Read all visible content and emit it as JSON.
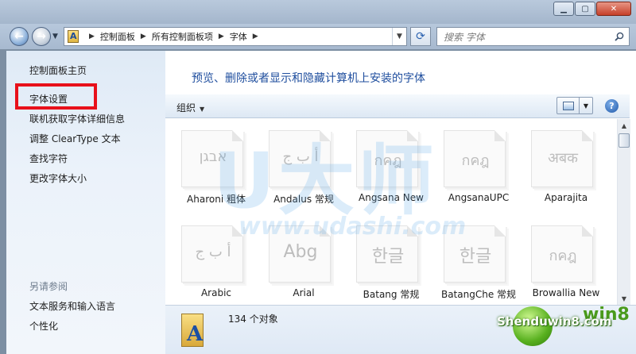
{
  "address_bar": {
    "breadcrumbs": [
      "控制面板",
      "所有控制面板项",
      "字体"
    ]
  },
  "search": {
    "placeholder": "搜索 字体"
  },
  "sidebar": {
    "home": "控制面板主页",
    "links": [
      "字体设置",
      "联机获取字体详细信息",
      "调整 ClearType 文本",
      "查找字符",
      "更改字体大小"
    ],
    "see_also_title": "另请参阅",
    "see_also": [
      "文本服务和输入语言",
      "个性化"
    ]
  },
  "main": {
    "title": "预览、删除或者显示和隐藏计算机上安装的字体",
    "organize": "组织",
    "fonts": [
      {
        "name": "Aharoni 粗体",
        "sample": "אבגן"
      },
      {
        "name": "Andalus 常规",
        "sample": "أ ب ج"
      },
      {
        "name": "Angsana New",
        "sample": "กคฎ"
      },
      {
        "name": "AngsanaUPC",
        "sample": "กคฎ"
      },
      {
        "name": "Aparajita",
        "sample": "अबक"
      },
      {
        "name": "Arabic",
        "sample": "أ ب ج"
      },
      {
        "name": "Arial",
        "sample": "Abg"
      },
      {
        "name": "Batang 常规",
        "sample": "한글"
      },
      {
        "name": "BatangChe 常规",
        "sample": "한글"
      },
      {
        "name": "Browallia New",
        "sample": "กคฎ"
      }
    ]
  },
  "details": {
    "count": "134 个对象"
  },
  "icons": [
    "back-icon",
    "forward-icon",
    "refresh-icon",
    "search-icon",
    "help-icon",
    "view-icon"
  ],
  "watermark": {
    "text1": "U大师",
    "text2": "www.udashi.com",
    "logo_text": "Shenduwin8.com",
    "logo_cn": "win8"
  }
}
